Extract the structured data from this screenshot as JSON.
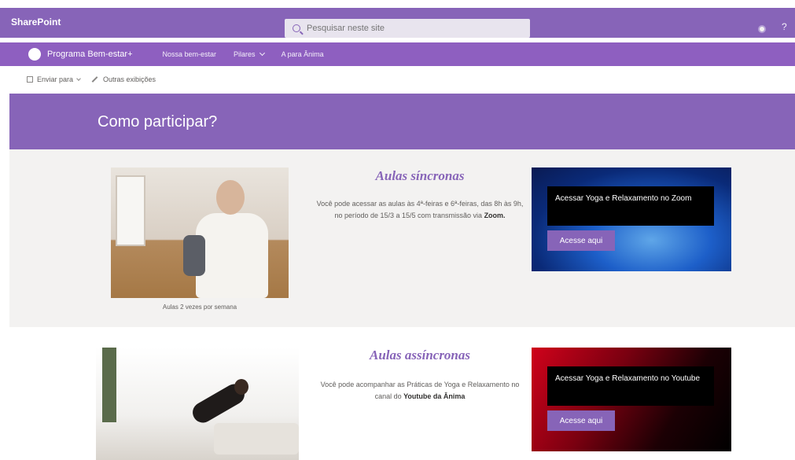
{
  "suitebar": {
    "brand": "SharePoint",
    "search_placeholder": "Pesquisar neste site"
  },
  "sitenav": {
    "site_name": "Programa Bem-estar+",
    "links": [
      {
        "label": "Nossa bem-estar"
      },
      {
        "label": "Pilares"
      },
      {
        "label": "A para Ânima"
      }
    ]
  },
  "commandbar": {
    "items": [
      {
        "label": "Enviar para"
      },
      {
        "label": "Outras exibições"
      }
    ]
  },
  "hero": {
    "title": "Como participar?"
  },
  "section1": {
    "caption": "Aulas 2 vezes por semana",
    "title": "Aulas síncronas",
    "text_before": "Você pode acessar as aulas às 4ª-feiras e 6ª-feiras, das 8h às 9h, no período de 15/3 a 15/5 com transmissão via ",
    "text_bold": "Zoom.",
    "card": {
      "label": "Acessar Yoga e Relaxamento no Zoom",
      "button": "Acesse aqui",
      "color": "#1d5fc9"
    }
  },
  "section2": {
    "title": "Aulas assíncronas",
    "text_before": "Você pode acompanhar as Práticas de Yoga e Relaxamento no canal do ",
    "text_bold": "Youtube da Ânima",
    "card": {
      "label": "Acessar Yoga e Relaxamento no Youtube",
      "button": "Acesse aqui",
      "color": "#d0021b"
    }
  },
  "colors": {
    "accent": "#8764b8"
  }
}
